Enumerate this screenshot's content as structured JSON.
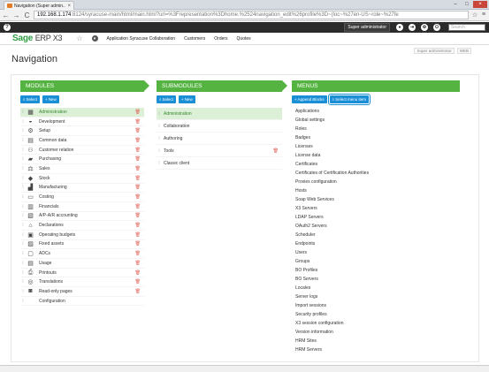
{
  "browser": {
    "tab_title": "Navigation (Super admin...",
    "url_host": "192.168.1.174",
    "url_rest": ":8124/syracuse-main/html/main.html?url=%3Frepresentation%3Dhome.%2524navigation_edit%26profile%3D~(loc~%27en-US~role~%27fe"
  },
  "apphead": {
    "user": "Super administrator",
    "search_placeholder": "Search"
  },
  "sagebar": {
    "brand": "Sage",
    "brand_suffix": "ERP X3",
    "links": [
      "Application Syracuse Collaboration",
      "Customers",
      "Orders",
      "Quotes"
    ]
  },
  "page": {
    "title": "Navigation",
    "tools": [
      "Super administrator",
      "WEB"
    ]
  },
  "modules": {
    "header": "MODULES",
    "select_label": "Select",
    "new_label": "New",
    "items": [
      {
        "label": "Administration",
        "icon": "admin-icon"
      },
      {
        "label": "Development",
        "icon": "development-icon"
      },
      {
        "label": "Setup",
        "icon": "gear-icon"
      },
      {
        "label": "Common data",
        "icon": "common-data-icon"
      },
      {
        "label": "Customer relation",
        "icon": "customer-relation-icon"
      },
      {
        "label": "Purchasing",
        "icon": "purchasing-icon"
      },
      {
        "label": "Sales",
        "icon": "sales-icon"
      },
      {
        "label": "Stock",
        "icon": "stock-icon"
      },
      {
        "label": "Manufacturing",
        "icon": "manufacturing-icon"
      },
      {
        "label": "Costing",
        "icon": "costing-icon"
      },
      {
        "label": "Financials",
        "icon": "financials-icon"
      },
      {
        "label": "A/P-A/R accounting",
        "icon": "stats-icon"
      },
      {
        "label": "Declarations",
        "icon": "declarations-icon"
      },
      {
        "label": "Operating budgets",
        "icon": "budgets-icon"
      },
      {
        "label": "Fixed assets",
        "icon": "fixed-assets-icon"
      },
      {
        "label": "ADCs",
        "icon": "adc-icon"
      },
      {
        "label": "Usage",
        "icon": "usage-icon"
      },
      {
        "label": "Printouts",
        "icon": "printer-icon"
      },
      {
        "label": "Translations",
        "icon": "translations-icon"
      },
      {
        "label": "Read-only pages",
        "icon": "read-only-icon"
      },
      {
        "label": "Configuration",
        "icon": ""
      }
    ]
  },
  "submodules": {
    "header": "SUBMODULES",
    "select_label": "Select",
    "new_label": "New",
    "items": [
      "Administration",
      "Collaboration",
      "Authoring",
      "Tools",
      "Classic client"
    ]
  },
  "menus": {
    "header": "MENUS",
    "append_label": "Append Blocks",
    "select_label": "Select menu item",
    "items": [
      "Applications",
      "Global settings",
      "Roles",
      "Badges",
      "Licenses",
      "License data",
      "Certificates",
      "Certificates of Certification Authorities",
      "Proxies configuration",
      "Hosts",
      "Soap Web Services",
      "X3 Servers",
      "LDAP Servers",
      "OAuth2 Servers",
      "Scheduler",
      "Endpoints",
      "Users",
      "Groups",
      "BO Profiles",
      "BO Servers",
      "Locales",
      "Server logs",
      "Import sessions",
      "Security profiles",
      "X3 session configuration",
      "Version information",
      "HRM Sites",
      "HRM Servers"
    ]
  },
  "colors": {
    "accent_green": "#55b342",
    "button_blue": "#1a8fd6",
    "selected_row": "#dcefd7",
    "trash_red": "#e0645a"
  }
}
